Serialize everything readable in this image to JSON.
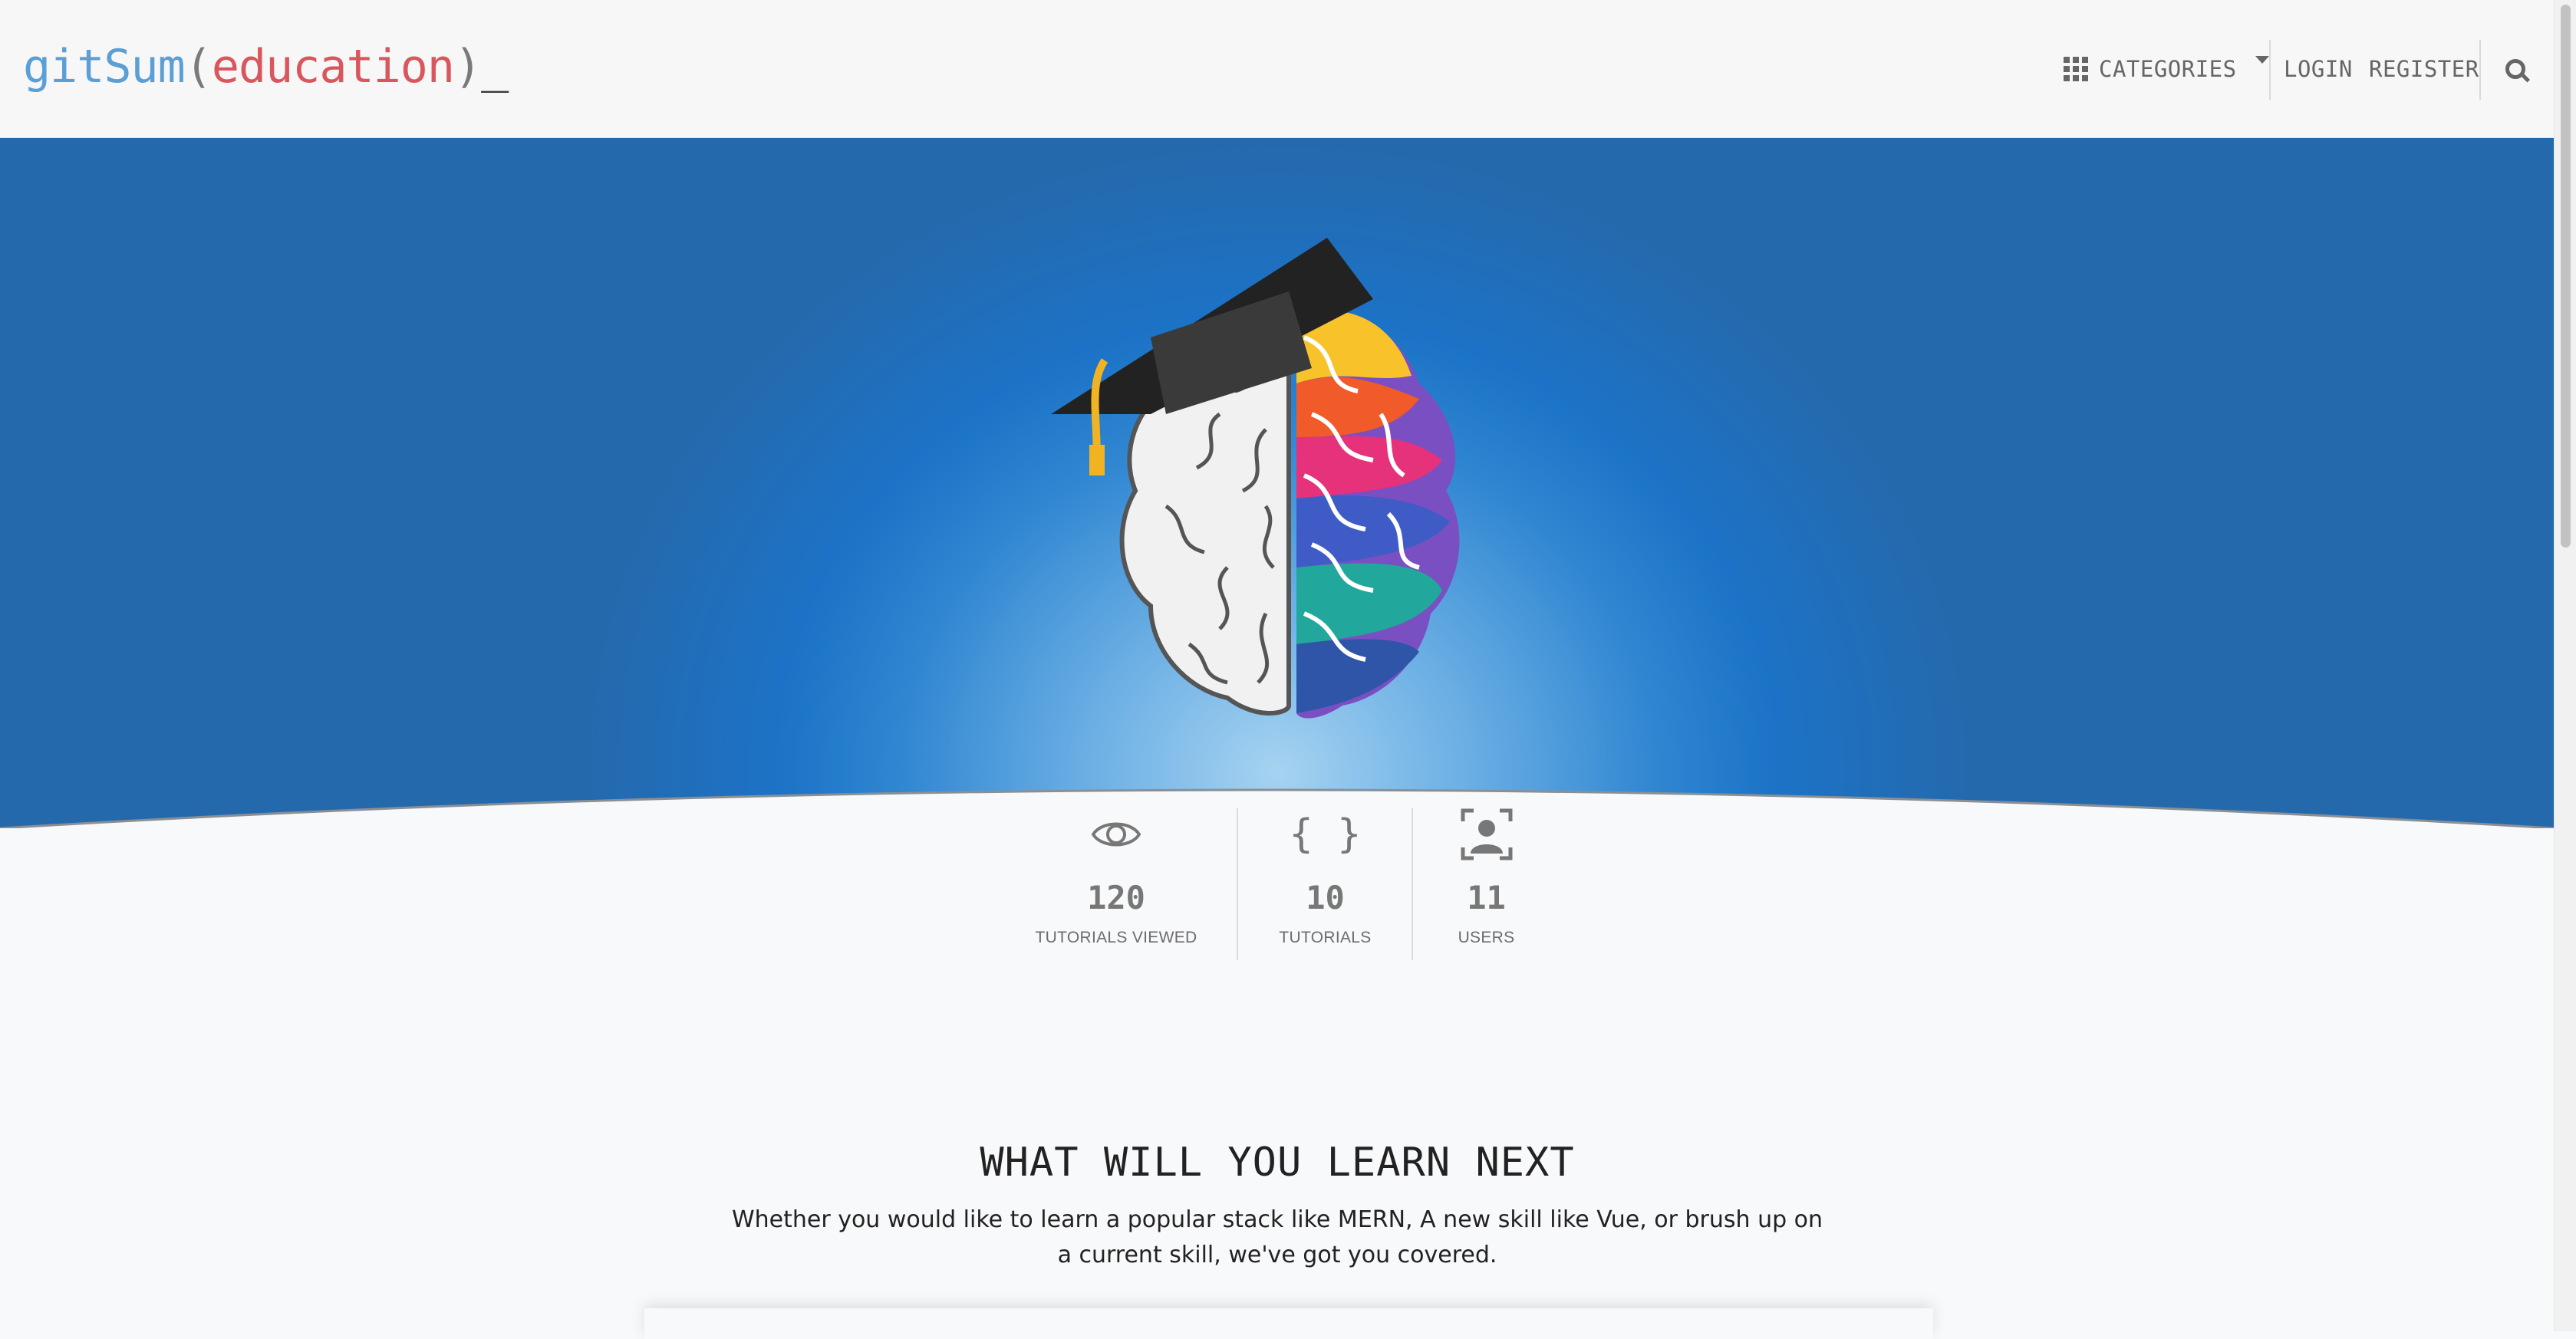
{
  "brand": {
    "name": "gitSum",
    "open_paren": "(",
    "arg": "education",
    "close_paren": ")",
    "cursor": "_"
  },
  "nav": {
    "categories_label": "CATEGORIES",
    "login_label": "LOGIN",
    "register_label": "REGISTER"
  },
  "stats": [
    {
      "icon": "eye-icon",
      "value": "120",
      "label": "TUTORIALS VIEWED"
    },
    {
      "icon": "code-braces-icon",
      "value": "10",
      "label": "TUTORIALS"
    },
    {
      "icon": "user-portrait-icon",
      "value": "11",
      "label": "USERS"
    }
  ],
  "learn": {
    "title": "WHAT WILL YOU LEARN NEXT",
    "text": "Whether you would like to learn a popular stack like MERN, A new skill like Vue, or brush up on a current skill, we've got you covered."
  },
  "colors": {
    "brand_blue": "#5a9fd6",
    "brand_red": "#d9565d",
    "hero_blue": "#1c73c7"
  }
}
